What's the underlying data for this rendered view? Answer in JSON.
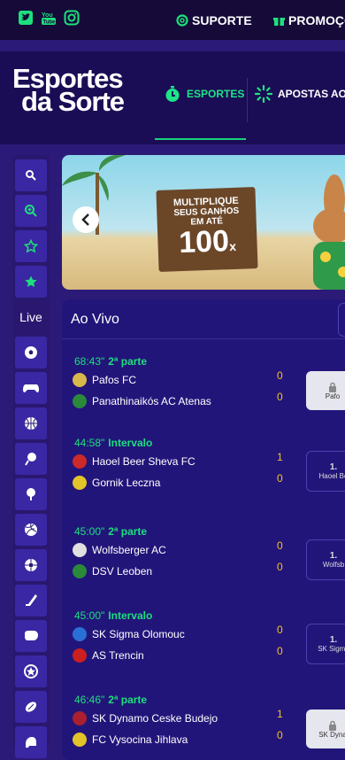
{
  "topbar": {
    "social": [
      "twitter-icon",
      "youtube-icon",
      "instagram-icon"
    ],
    "support_label": "SUPORTE",
    "promo_label": "PROMOÇÕ"
  },
  "header": {
    "logo_line1": "Esportes",
    "logo_line2": "da Sorte",
    "nav_esportes": "ESPORTES",
    "nav_apostas": "APOSTAS AO"
  },
  "sidebar": {
    "live_label": "Live",
    "items": [
      "search-icon",
      "zoom-in-icon",
      "star-outline-icon",
      "star-icon",
      "live",
      "soccer-icon",
      "esports-icon",
      "basketball-icon",
      "tennis-icon",
      "table-tennis-icon",
      "volleyball-icon",
      "futsal-icon",
      "hockey-icon",
      "boxing-icon",
      "shield-icon",
      "rugby-icon",
      "helmet-icon"
    ]
  },
  "banner": {
    "line1": "MULTIPLIQUE",
    "line2": "SEUS GANHOS",
    "line3": "EM ATÉ",
    "multiplier": "100",
    "suffix": "x"
  },
  "live": {
    "title": "Ao Vivo",
    "matches": [
      {
        "time": "68:43\"",
        "status": "2ª parte",
        "home": "Pafos FC",
        "away": "Panathinaikós AC Atenas",
        "home_score": "0",
        "away_score": "0",
        "odd_locked": true,
        "odd_label": "Pafo",
        "odd_value": ""
      },
      {
        "time": "44:58\"",
        "status": "Intervalo",
        "home": "Haoel Beer Sheva FC",
        "away": "Gornik Leczna",
        "home_score": "1",
        "away_score": "0",
        "odd_locked": false,
        "odd_label": "Haoel Be",
        "odd_value": "1."
      },
      {
        "time": "45:00\"",
        "status": "2ª parte",
        "home": "Wolfsberger AC",
        "away": "DSV Leoben",
        "home_score": "0",
        "away_score": "0",
        "odd_locked": false,
        "odd_label": "Wolfsb",
        "odd_value": "1."
      },
      {
        "time": "45:00\"",
        "status": "Intervalo",
        "home": "SK Sigma Olomouc",
        "away": "AS Trencin",
        "home_score": "0",
        "away_score": "0",
        "odd_locked": false,
        "odd_label": "SK Sigma",
        "odd_value": "1."
      },
      {
        "time": "46:46\"",
        "status": "2ª parte",
        "home": "SK Dynamo Ceske Budejo",
        "away": "FC Vysocina Jihlava",
        "home_score": "1",
        "away_score": "0",
        "odd_locked": true,
        "odd_label": "SK Dyna",
        "odd_value": ""
      }
    ]
  },
  "colors": {
    "accent_green": "#1de07c",
    "score_yellow": "#f2c327",
    "panel": "#22157a",
    "header": "#1b0d55"
  }
}
